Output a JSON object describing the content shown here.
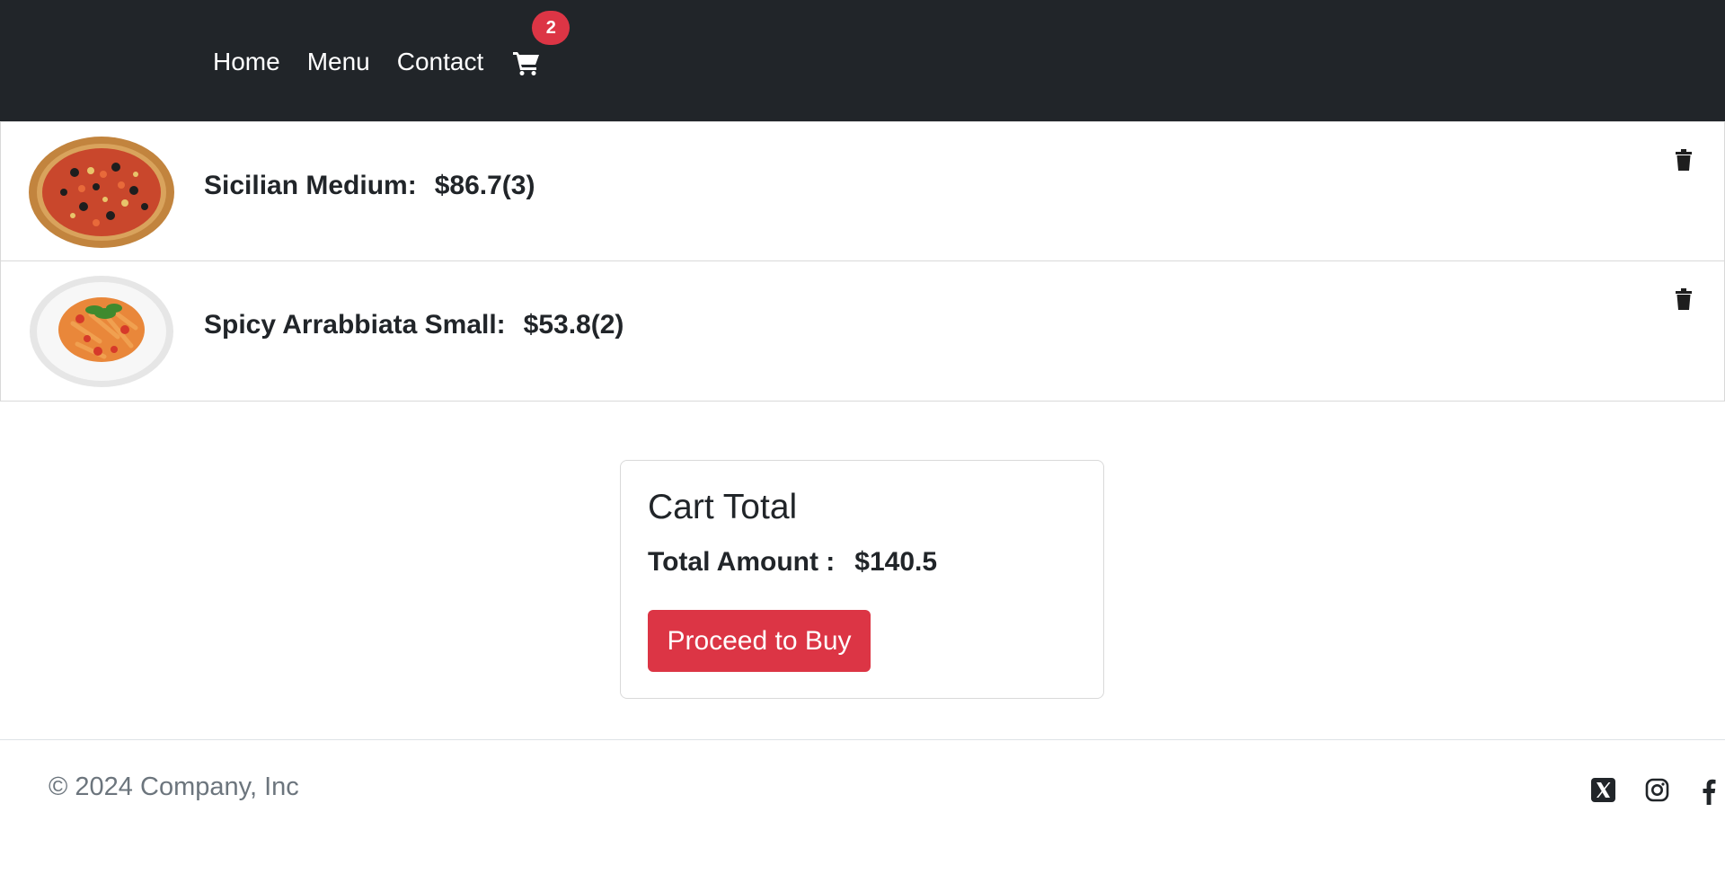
{
  "nav": {
    "links": [
      "Home",
      "Menu",
      "Contact"
    ],
    "cart_count": "2"
  },
  "cart": {
    "items": [
      {
        "name": "Sicilian Medium:",
        "price": "$86.7(3)",
        "image": "pizza"
      },
      {
        "name": "Spicy Arrabbiata Small:",
        "price": "$53.8(2)",
        "image": "pasta"
      }
    ]
  },
  "total": {
    "title": "Cart Total",
    "label": "Total Amount :",
    "amount": "$140.5",
    "button": "Proceed to Buy"
  },
  "footer": {
    "copyright": "© 2024 Company, Inc",
    "social": [
      "x-icon",
      "instagram-icon",
      "facebook-icon"
    ]
  },
  "colors": {
    "navbar_bg": "#212529",
    "accent_red": "#dc3545",
    "text_dark": "#212529",
    "text_muted": "#6c757d"
  }
}
